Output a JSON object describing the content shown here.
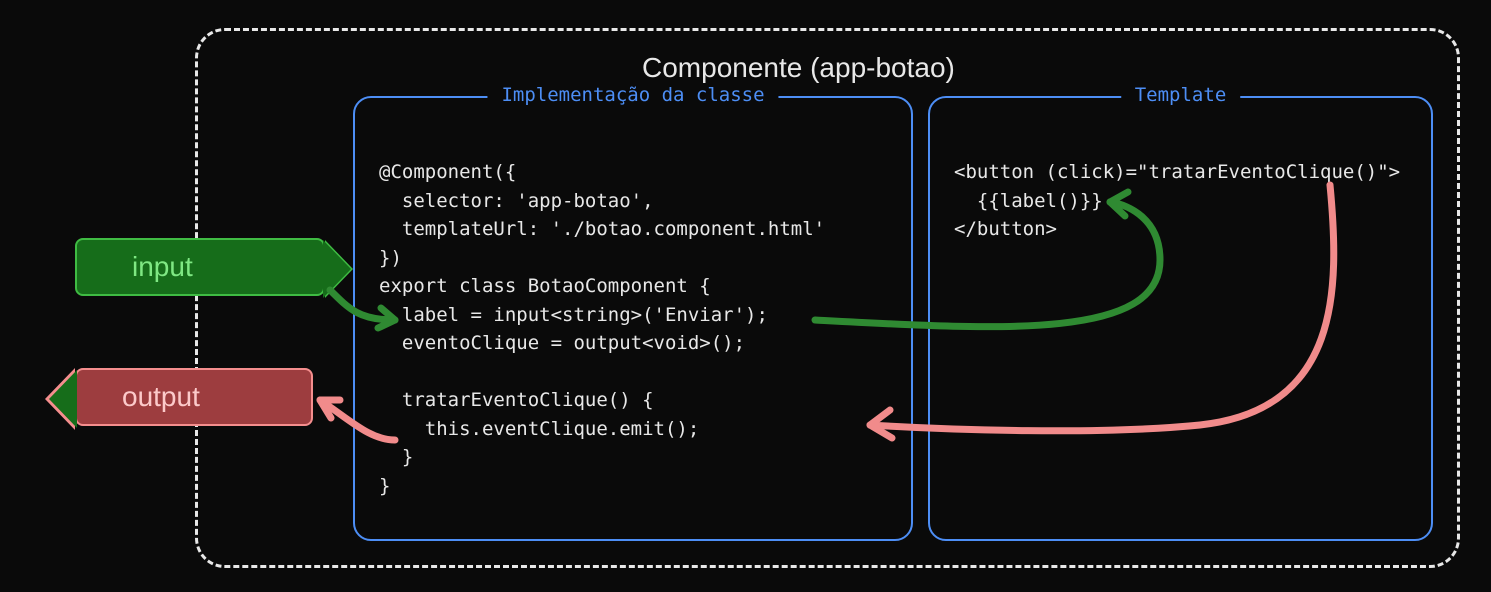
{
  "outer": {
    "title": "Componente (app-botao)"
  },
  "panels": {
    "left": {
      "title": "Implementação da classe",
      "code": "@Component({\n  selector: 'app-botao',\n  templateUrl: './botao.component.html'\n})\nexport class BotaoComponent {\n  label = input<string>('Enviar');\n  eventoClique = output<void>();\n\n  tratarEventoClique() {\n    this.eventClique.emit();\n  }\n}"
    },
    "right": {
      "title": "Template",
      "code": "<button (click)=\"tratarEventoClique()\">\n  {{label()}}\n</button>"
    }
  },
  "tags": {
    "input": "input",
    "output": "output"
  }
}
